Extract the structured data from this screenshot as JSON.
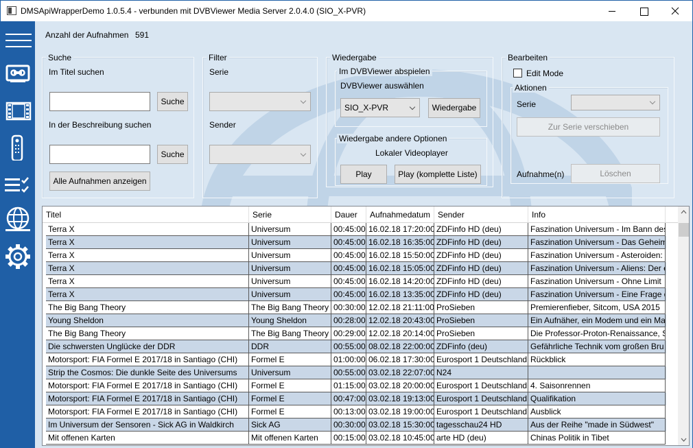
{
  "window": {
    "title": "DMSApiWrapperDemo 1.0.5.4 - verbunden mit DVBViewer Media Server 2.0.4.0 (SIO_X-PVR)"
  },
  "sidebar": {
    "items": [
      {
        "name": "menu",
        "icon": "hamburger-icon"
      },
      {
        "name": "recordings",
        "icon": "tape-icon"
      },
      {
        "name": "videos",
        "icon": "film-icon"
      },
      {
        "name": "remote",
        "icon": "remote-icon"
      },
      {
        "name": "tasks",
        "icon": "checklist-icon"
      },
      {
        "name": "network",
        "icon": "globe-icon"
      },
      {
        "name": "settings",
        "icon": "gear-icon"
      }
    ]
  },
  "header": {
    "count_label": "Anzahl der Aufnahmen",
    "count_value": "591"
  },
  "search": {
    "title": "Suche",
    "title_label": "Im Titel suchen",
    "title_value": "",
    "title_button": "Suche",
    "desc_label": "In der Beschreibung suchen",
    "desc_value": "",
    "desc_button": "Suche",
    "show_all_button": "Alle Aufnahmen anzeigen"
  },
  "filter": {
    "title": "Filter",
    "series_label": "Serie",
    "series_value": "",
    "channel_label": "Sender",
    "channel_value": ""
  },
  "playback": {
    "title": "Wiedergabe",
    "dvb_group_title": "Im DVBViewer abspielen",
    "dvb_select_label": "DVBViewer auswählen",
    "dvb_selected": "SIO_X-PVR",
    "dvb_play_button": "Wiedergabe",
    "other_group_title": "Wiedergabe andere Optionen",
    "local_player_label": "Lokaler Videoplayer",
    "play_button": "Play",
    "play_list_button": "Play (komplette Liste)"
  },
  "edit": {
    "title": "Bearbeiten",
    "edit_mode_label": "Edit Mode",
    "edit_mode_checked": false,
    "actions_title": "Aktionen",
    "series_label": "Serie",
    "series_value": "",
    "move_button": "Zur Serie verschieben",
    "recordings_label": "Aufnahme(n)",
    "delete_button": "Löschen"
  },
  "table": {
    "columns": [
      "Titel",
      "Serie",
      "Dauer",
      "Aufnahmedatum",
      "Sender",
      "Info"
    ],
    "rows": [
      [
        "Terra X",
        "Universum",
        "00:45:00",
        "16.02.18 17:20:00",
        "ZDFinfo HD (deu)",
        "Faszination Universum - Im Bann des"
      ],
      [
        "Terra X",
        "Universum",
        "00:45:00",
        "16.02.18 16:35:00",
        "ZDFinfo HD (deu)",
        "Faszination Universum - Das Geheim"
      ],
      [
        "Terra X",
        "Universum",
        "00:45:00",
        "16.02.18 15:50:00",
        "ZDFinfo HD (deu)",
        "Faszination Universum - Asteroiden:"
      ],
      [
        "Terra X",
        "Universum",
        "00:45:00",
        "16.02.18 15:05:00",
        "ZDFinfo HD (deu)",
        "Faszination Universum - Aliens: Der e"
      ],
      [
        "Terra X",
        "Universum",
        "00:45:00",
        "16.02.18 14:20:00",
        "ZDFinfo HD (deu)",
        "Faszination Universum - Ohne Limit"
      ],
      [
        "Terra X",
        "Universum",
        "00:45:00",
        "16.02.18 13:35:00",
        "ZDFinfo HD (deu)",
        "Faszination Universum - Eine Frage d"
      ],
      [
        "The Big Bang Theory",
        "The Big Bang Theory",
        "00:30:00",
        "12.02.18 21:11:00",
        "ProSieben",
        "Premierenfieber, Sitcom, USA 2015"
      ],
      [
        "Young Sheldon",
        "Young Sheldon",
        "00:28:00",
        "12.02.18 20:43:00",
        "ProSieben",
        "Ein Aufnäher, ein Modem und ein Ma"
      ],
      [
        "The Big Bang Theory",
        "The Big Bang Theory",
        "00:29:00",
        "12.02.18 20:14:00",
        "ProSieben",
        "Die Professor-Proton-Renaissance, Si"
      ],
      [
        "Die schwersten Unglücke der DDR",
        "DDR",
        "00:55:00",
        "08.02.18 22:00:00",
        "ZDFinfo (deu)",
        "Gefährliche Technik vom großen Bru"
      ],
      [
        "Motorsport: FIA Formel E 2017/18 in Santiago (CHI)",
        "Formel E",
        "01:00:00",
        "06.02.18 17:30:00",
        "Eurosport 1 Deutschland",
        "Rückblick"
      ],
      [
        "Strip the Cosmos: Die dunkle Seite des Universums",
        "Universum",
        "00:55:00",
        "03.02.18 22:07:00",
        "N24",
        ""
      ],
      [
        "Motorsport: FIA Formel E 2017/18 in Santiago (CHI)",
        "Formel E",
        "01:15:00",
        "03.02.18 20:00:00",
        "Eurosport 1 Deutschland",
        "4. Saisonrennen"
      ],
      [
        "Motorsport: FIA Formel E 2017/18 in Santiago (CHI)",
        "Formel E",
        "00:47:00",
        "03.02.18 19:13:00",
        "Eurosport 1 Deutschland",
        "Qualifikation"
      ],
      [
        "Motorsport: FIA Formel E 2017/18 in Santiago (CHI)",
        "Formel E",
        "00:13:00",
        "03.02.18 19:00:00",
        "Eurosport 1 Deutschland",
        "Ausblick"
      ],
      [
        "Im Universum der Sensoren - Sick AG in Waldkirch",
        "Sick AG",
        "00:30:00",
        "03.02.18 15:30:00",
        "tagesschau24 HD",
        "Aus der Reihe \"made in Südwest\""
      ],
      [
        "Mit offenen Karten",
        "Mit offenen Karten",
        "00:15:00",
        "03.02.18 10:45:00",
        "arte HD (deu)",
        "Chinas Politik in Tibet"
      ]
    ]
  },
  "colors": {
    "sidebar": "#1f5fa6",
    "content_bg": "#d9e6f2",
    "alt_row": "#c9d7e7"
  }
}
